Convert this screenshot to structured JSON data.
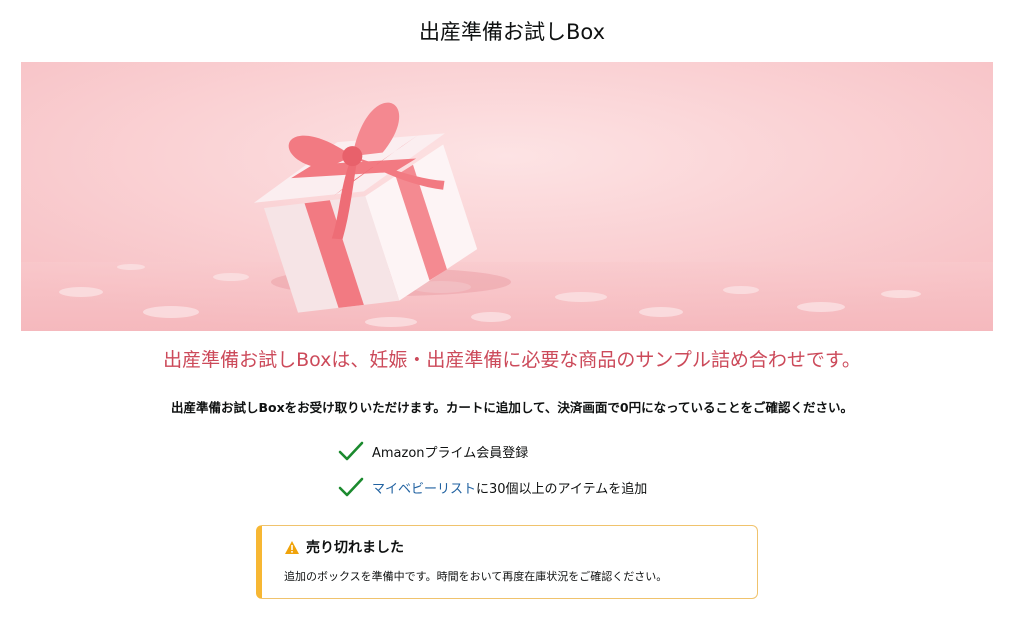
{
  "page": {
    "title": "出産準備お試しBox"
  },
  "hero": {
    "image_subject": "gift-box-with-pink-ribbon",
    "colors": {
      "background": "#fbd3d5",
      "ribbon": "#f27a82",
      "box": "#f8e9ea"
    }
  },
  "intro": {
    "subtitle": "出産準備お試しBoxは、妊娠・出産準備に必要な商品のサンプル詰め合わせです。",
    "instruction": "出産準備お試しBoxをお受け取りいただけます。カートに追加して、決済画面で0円になっていることをご確認ください。"
  },
  "requirements": [
    {
      "icon": "check-icon",
      "text": "Amazonプライム会員登録"
    },
    {
      "icon": "check-icon",
      "link_text": "マイベビーリスト",
      "text": "に30個以上のアイテムを追加"
    }
  ],
  "alert": {
    "icon": "warning-icon",
    "title": "売り切れました",
    "message": "追加のボックスを準備中です。時間をおいて再度在庫状況をご確認ください。"
  },
  "colors": {
    "accent_text": "#cc4a5a",
    "link": "#2162a1",
    "check": "#1b8a2e",
    "alert_border": "#f7b733",
    "warning": "#f0a30a"
  }
}
